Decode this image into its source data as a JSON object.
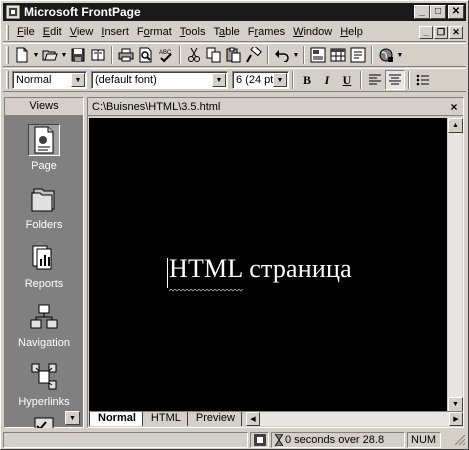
{
  "app": {
    "title": "Microsoft FrontPage",
    "caption_buttons": {
      "minimize": "_",
      "maximize": "□",
      "close": "✕"
    }
  },
  "menubar": {
    "items": [
      {
        "label": "File",
        "access_key": "F"
      },
      {
        "label": "Edit",
        "access_key": "E"
      },
      {
        "label": "View",
        "access_key": "V"
      },
      {
        "label": "Insert",
        "access_key": "I"
      },
      {
        "label": "Format",
        "access_key": "o"
      },
      {
        "label": "Tools",
        "access_key": "T"
      },
      {
        "label": "Table",
        "access_key": "a"
      },
      {
        "label": "Frames",
        "access_key": "r"
      },
      {
        "label": "Window",
        "access_key": "W"
      },
      {
        "label": "Help",
        "access_key": "H"
      }
    ],
    "mdi_buttons": {
      "minimize": "_",
      "restore": "❐",
      "close": "✕"
    }
  },
  "toolbar_standard": {
    "buttons": [
      "new-page-icon",
      "open-folder-icon",
      "save-icon",
      "publish-icon",
      "print-icon",
      "print-preview-icon",
      "spelling-icon",
      "cut-icon",
      "copy-icon",
      "paste-icon",
      "format-painter-icon",
      "undo-icon",
      "insert-component-icon",
      "insert-table-icon",
      "hyperlink-icon",
      "web-icon"
    ]
  },
  "toolbar_formatting": {
    "style_value": "Normal",
    "font_value": "(default font)",
    "size_value": "6  (24 pt)",
    "bold_label": "B",
    "italic_label": "I",
    "underline_label": "U"
  },
  "views": {
    "header": "Views",
    "items": [
      {
        "label": "Page",
        "icon": "page-view-icon",
        "selected": true
      },
      {
        "label": "Folders",
        "icon": "folders-view-icon",
        "selected": false
      },
      {
        "label": "Reports",
        "icon": "reports-view-icon",
        "selected": false
      },
      {
        "label": "Navigation",
        "icon": "navigation-view-icon",
        "selected": false
      },
      {
        "label": "Hyperlinks",
        "icon": "hyperlinks-view-icon",
        "selected": false
      }
    ]
  },
  "document": {
    "path": "C:\\Buisnes\\HTML\\3.5.html",
    "close_label": "×",
    "heading": "HTML страница",
    "background_color": "#000000",
    "text_color": "#ffffff"
  },
  "tabs": [
    {
      "label": "Normal",
      "active": true
    },
    {
      "label": "HTML",
      "active": false
    },
    {
      "label": "Preview",
      "active": false
    }
  ],
  "statusbar": {
    "download_time": "0 seconds over 28.8",
    "num": "NUM"
  }
}
